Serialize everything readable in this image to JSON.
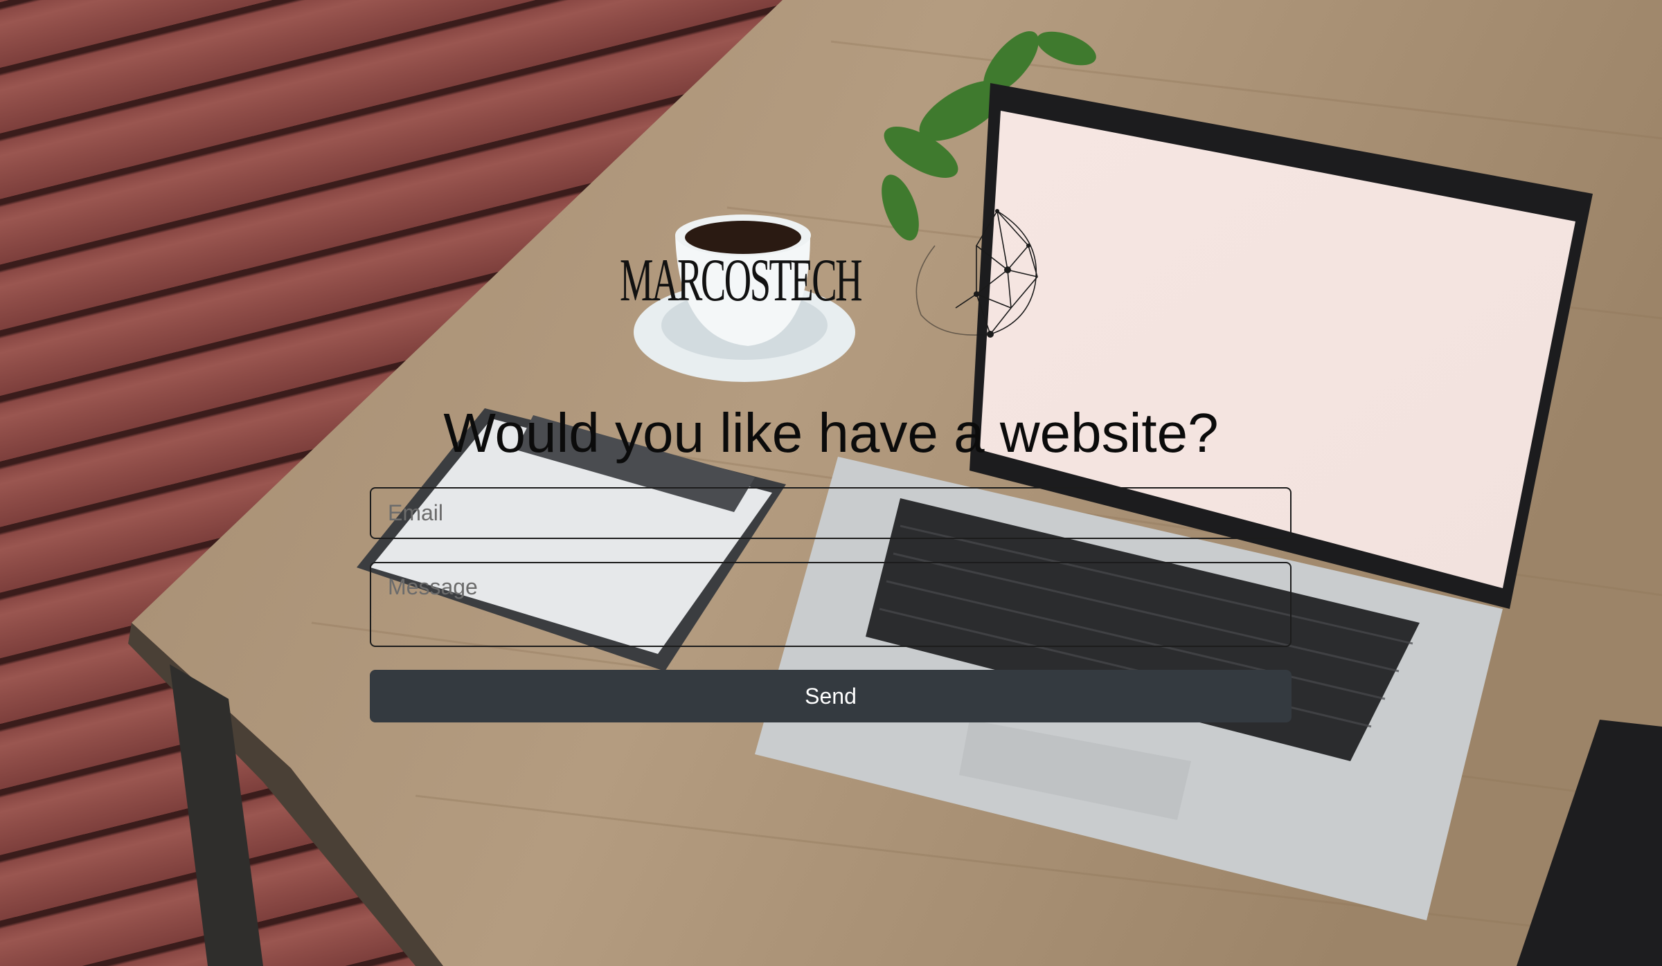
{
  "brand": {
    "logo_text": "MARCOSTECH",
    "logo_icon": "geodesic-sphere-icon"
  },
  "hero": {
    "headline": "Would you like have a website?"
  },
  "form": {
    "email": {
      "placeholder": "Email",
      "value": ""
    },
    "message": {
      "placeholder": "Message",
      "value": ""
    },
    "send_label": "Send"
  },
  "colors": {
    "button_bg": "#343a40",
    "button_text": "#ffffff",
    "field_border": "#1c1c1c",
    "headline": "#0b0b0b"
  }
}
